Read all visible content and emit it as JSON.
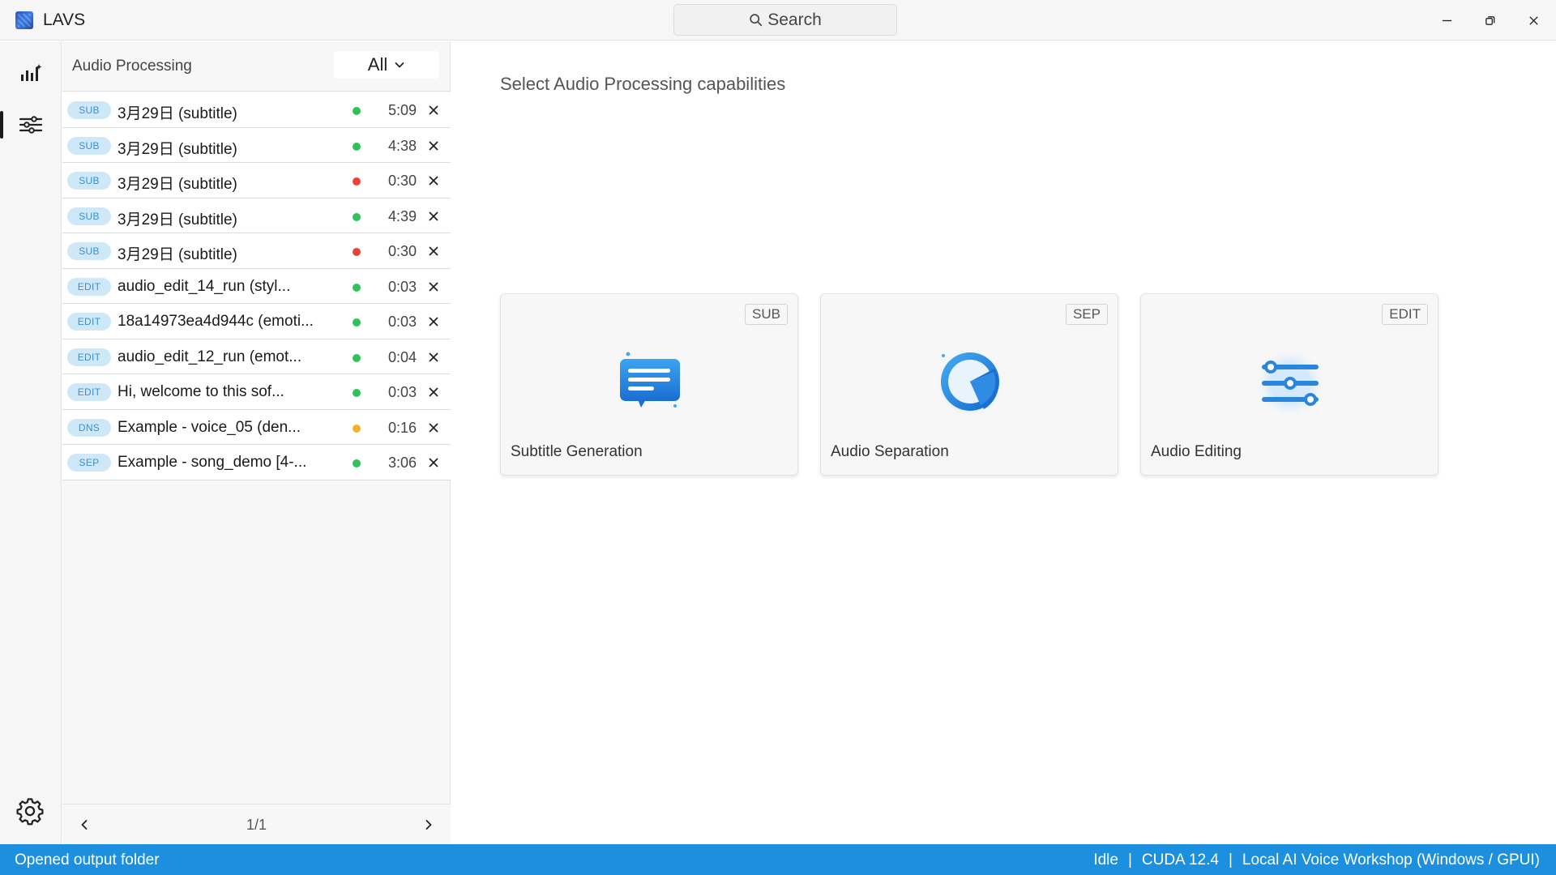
{
  "app": {
    "title": "LAVS"
  },
  "search": {
    "placeholder": "Search"
  },
  "panel": {
    "title": "Audio Processing",
    "filter_value": "All",
    "tasks": [
      {
        "type": "SUB",
        "name": "3月29日 (subtitle)",
        "status_color": "#2ec25b",
        "duration": "5:09"
      },
      {
        "type": "SUB",
        "name": "3月29日 (subtitle)",
        "status_color": "#2ec25b",
        "duration": "4:38"
      },
      {
        "type": "SUB",
        "name": "3月29日 (subtitle)",
        "status_color": "#e8423a",
        "duration": "0:30"
      },
      {
        "type": "SUB",
        "name": "3月29日 (subtitle)",
        "status_color": "#2ec25b",
        "duration": "4:39"
      },
      {
        "type": "SUB",
        "name": "3月29日 (subtitle)",
        "status_color": "#e8423a",
        "duration": "0:30"
      },
      {
        "type": "EDIT",
        "name": "audio_edit_14_run (styl...",
        "status_color": "#2ec25b",
        "duration": "0:03"
      },
      {
        "type": "EDIT",
        "name": "18a14973ea4d944c (emoti...",
        "status_color": "#2ec25b",
        "duration": "0:03"
      },
      {
        "type": "EDIT",
        "name": "audio_edit_12_run (emot...",
        "status_color": "#2ec25b",
        "duration": "0:04"
      },
      {
        "type": "EDIT",
        "name": "Hi, welcome to this sof...",
        "status_color": "#2ec25b",
        "duration": "0:03"
      },
      {
        "type": "DNS",
        "name": "Example - voice_05 (den...",
        "status_color": "#f0b429",
        "duration": "0:16"
      },
      {
        "type": "SEP",
        "name": "Example - song_demo [4-...",
        "status_color": "#2ec25b",
        "duration": "3:06"
      }
    ],
    "pager_label": "1/1"
  },
  "main": {
    "title": "Select Audio Processing capabilities",
    "cards": [
      {
        "tag": "SUB",
        "label": "Subtitle Generation",
        "icon": "subtitle-icon"
      },
      {
        "tag": "SEP",
        "label": "Audio Separation",
        "icon": "separation-icon"
      },
      {
        "tag": "EDIT",
        "label": "Audio Editing",
        "icon": "editing-icon"
      }
    ]
  },
  "statusbar": {
    "message": "Opened output folder",
    "state": "Idle",
    "separator": "|",
    "cuda": "CUDA 12.4",
    "product": "Local AI Voice Workshop (Windows / GPUI)"
  },
  "colors": {
    "accent": "#1c8fdf",
    "badge_bg": "#cfe8f8",
    "badge_text": "#3a8fd0",
    "status_ok": "#2ec25b",
    "status_error": "#e8423a",
    "status_warn": "#f0b429"
  }
}
